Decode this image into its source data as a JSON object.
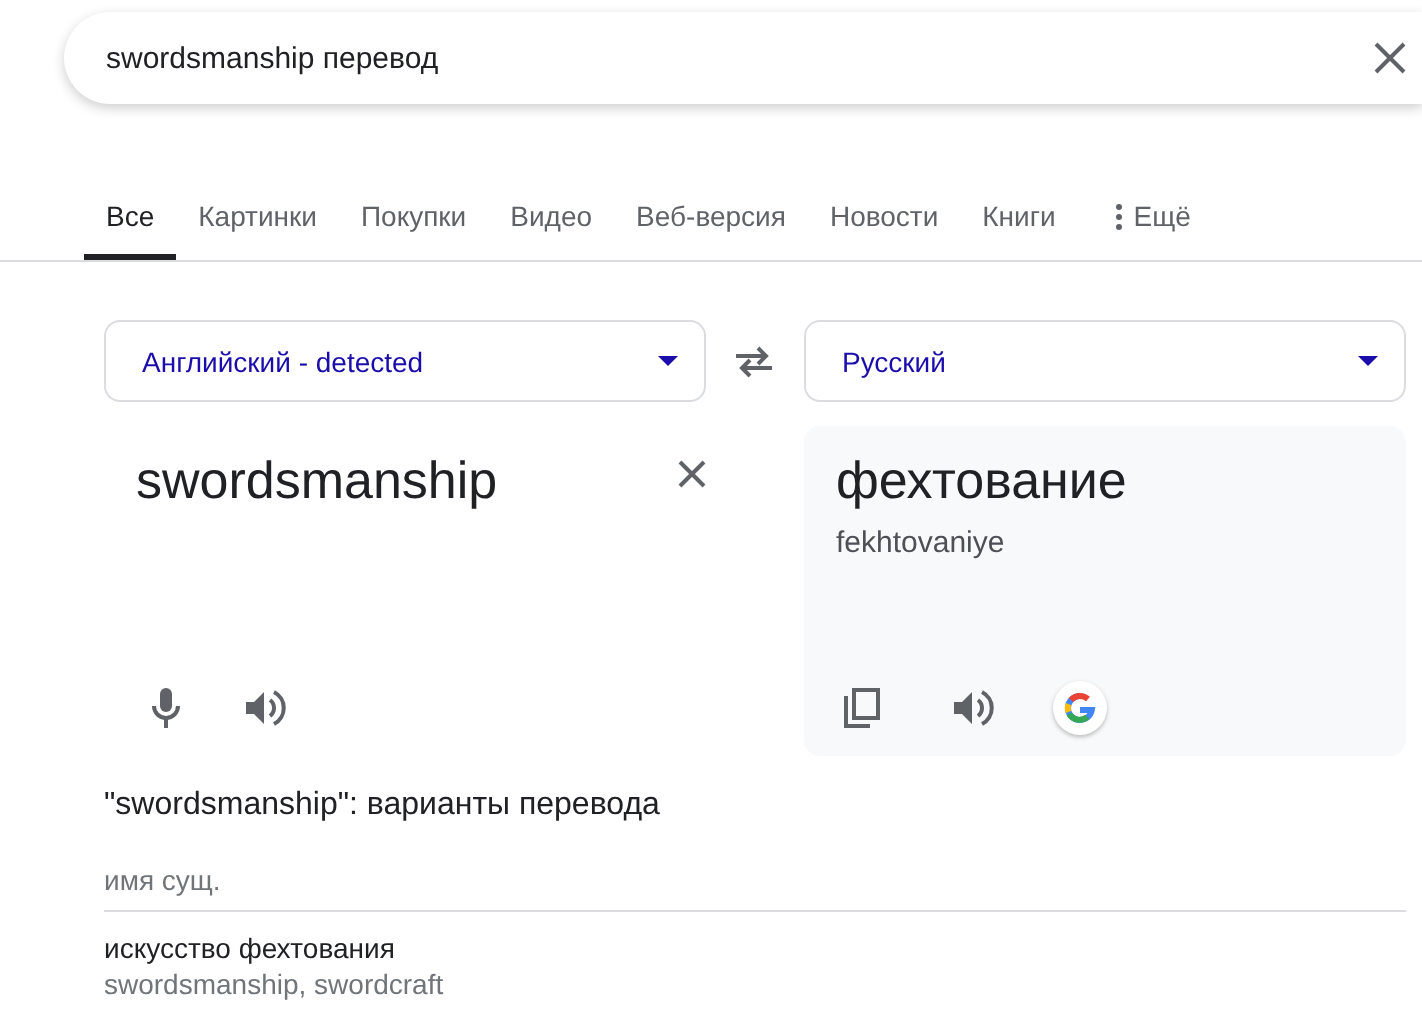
{
  "search": {
    "value": "swordsmanship перевод"
  },
  "tabs": [
    {
      "label": "Все",
      "selected": true
    },
    {
      "label": "Картинки",
      "selected": false
    },
    {
      "label": "Покупки",
      "selected": false
    },
    {
      "label": "Видео",
      "selected": false
    },
    {
      "label": "Веб-версия",
      "selected": false
    },
    {
      "label": "Новости",
      "selected": false
    },
    {
      "label": "Книги",
      "selected": false
    },
    {
      "label": "Ещё",
      "selected": false,
      "kind": "more"
    }
  ],
  "translator": {
    "source_language": "Английский - detected",
    "target_language": "Русский",
    "source_text": "swordsmanship",
    "translation": "фехтование",
    "transliteration": "fekhtovaniye"
  },
  "variants": {
    "heading": "\"swordsmanship\": варианты перевода",
    "groups": [
      {
        "part_of_speech": "имя сущ.",
        "entries": [
          {
            "translation": "искусство фехтования",
            "synonyms": "swordsmanship, swordcraft"
          }
        ]
      }
    ]
  }
}
